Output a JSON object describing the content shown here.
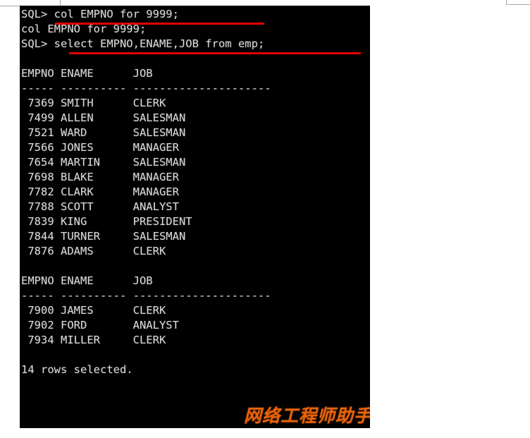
{
  "window": {
    "background_color": "#000000",
    "text_color": "#d6d6d6",
    "highlight_color": "#e40000",
    "watermark_color": "#e8620a"
  },
  "terminal": {
    "prompt": "SQL>",
    "lines": [
      {
        "id": "line-cmd-1",
        "text": "SQL> col EMPNO for 9999;"
      },
      {
        "id": "line-echo-1",
        "text": "col EMPNO for 9999;"
      },
      {
        "id": "line-cmd-2",
        "text": "SQL> select EMPNO,ENAME,JOB from emp;"
      },
      {
        "id": "line-blank-1",
        "text": " "
      },
      {
        "id": "line-header-1",
        "text": "EMPNO ENAME      JOB"
      },
      {
        "id": "line-rule-1",
        "text": "----- ---------- ---------------------"
      },
      {
        "id": "line-row-1",
        "text": " 7369 SMITH      CLERK"
      },
      {
        "id": "line-row-2",
        "text": " 7499 ALLEN      SALESMAN"
      },
      {
        "id": "line-row-3",
        "text": " 7521 WARD       SALESMAN"
      },
      {
        "id": "line-row-4",
        "text": " 7566 JONES      MANAGER"
      },
      {
        "id": "line-row-5",
        "text": " 7654 MARTIN     SALESMAN"
      },
      {
        "id": "line-row-6",
        "text": " 7698 BLAKE      MANAGER"
      },
      {
        "id": "line-row-7",
        "text": " 7782 CLARK      MANAGER"
      },
      {
        "id": "line-row-8",
        "text": " 7788 SCOTT      ANALYST"
      },
      {
        "id": "line-row-9",
        "text": " 7839 KING       PRESIDENT"
      },
      {
        "id": "line-row-10",
        "text": " 7844 TURNER     SALESMAN"
      },
      {
        "id": "line-row-11",
        "text": " 7876 ADAMS      CLERK"
      },
      {
        "id": "line-blank-2",
        "text": " "
      },
      {
        "id": "line-header-2",
        "text": "EMPNO ENAME      JOB"
      },
      {
        "id": "line-rule-2",
        "text": "----- ---------- ---------------------"
      },
      {
        "id": "line-row-12",
        "text": " 7900 JAMES      CLERK"
      },
      {
        "id": "line-row-13",
        "text": " 7902 FORD       ANALYST"
      },
      {
        "id": "line-row-14",
        "text": " 7934 MILLER     CLERK"
      },
      {
        "id": "line-blank-3",
        "text": " "
      },
      {
        "id": "line-footer",
        "text": "14 rows selected."
      }
    ],
    "columns": [
      "EMPNO",
      "ENAME",
      "JOB"
    ],
    "rows": [
      {
        "EMPNO": "7369",
        "ENAME": "SMITH",
        "JOB": "CLERK"
      },
      {
        "EMPNO": "7499",
        "ENAME": "ALLEN",
        "JOB": "SALESMAN"
      },
      {
        "EMPNO": "7521",
        "ENAME": "WARD",
        "JOB": "SALESMAN"
      },
      {
        "EMPNO": "7566",
        "ENAME": "JONES",
        "JOB": "MANAGER"
      },
      {
        "EMPNO": "7654",
        "ENAME": "MARTIN",
        "JOB": "SALESMAN"
      },
      {
        "EMPNO": "7698",
        "ENAME": "BLAKE",
        "JOB": "MANAGER"
      },
      {
        "EMPNO": "7782",
        "ENAME": "CLARK",
        "JOB": "MANAGER"
      },
      {
        "EMPNO": "7788",
        "ENAME": "SCOTT",
        "JOB": "ANALYST"
      },
      {
        "EMPNO": "7839",
        "ENAME": "KING",
        "JOB": "PRESIDENT"
      },
      {
        "EMPNO": "7844",
        "ENAME": "TURNER",
        "JOB": "SALESMAN"
      },
      {
        "EMPNO": "7876",
        "ENAME": "ADAMS",
        "JOB": "CLERK"
      },
      {
        "EMPNO": "7900",
        "ENAME": "JAMES",
        "JOB": "CLERK"
      },
      {
        "EMPNO": "7902",
        "ENAME": "FORD",
        "JOB": "ANALYST"
      },
      {
        "EMPNO": "7934",
        "ENAME": "MILLER",
        "JOB": "CLERK"
      }
    ],
    "row_count_message": "14 rows selected."
  },
  "watermark": {
    "text": "网络工程师助手"
  }
}
